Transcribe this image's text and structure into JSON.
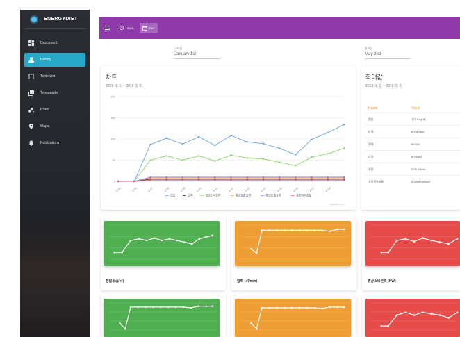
{
  "sidebar": {
    "brand": "ENERGYDIET",
    "items": [
      {
        "label": "Dashboard",
        "icon": "dashboard-icon"
      },
      {
        "label": "History",
        "icon": "person-icon",
        "active": true
      },
      {
        "label": "Table List",
        "icon": "clipboard-icon"
      },
      {
        "label": "Typography",
        "icon": "library-icon"
      },
      {
        "label": "Icons",
        "icon": "bubble-icon"
      },
      {
        "label": "Maps",
        "icon": "location-icon"
      },
      {
        "label": "Notifications",
        "icon": "bell-icon"
      }
    ]
  },
  "topbar": {
    "hour_label": "HOUR",
    "day_label": "DAY"
  },
  "dates": {
    "start_label": "시작일",
    "start_value": "January 1st",
    "end_label": "종료일",
    "end_value": "May 2nd"
  },
  "chart_card": {
    "title": "차트",
    "subtitle": "2019. 1. 1. ~ 2019. 5. 2.",
    "credit": "Highcharts.com"
  },
  "max_card": {
    "title": "최대값",
    "subtitle": "2019. 1. 1. ~ 2019. 5. 2.",
    "headers": [
      "Name",
      "Value"
    ],
    "rows": [
      {
        "name": "전압",
        "value": "172.9 kg/㎥"
      },
      {
        "name": "압력",
        "value": "6.9 ㎥/min"
      },
      {
        "name": "전력",
        "value": "99 KW"
      },
      {
        "name": "압력",
        "value": "6.9 kg/㎥"
      },
      {
        "name": "유량",
        "value": "0.05 ㎥/min"
      },
      {
        "name": "공정전력비율",
        "value": "0.1898 KWh/㎥"
      }
    ]
  },
  "mini_cards": [
    {
      "label": "전압 (kg/㎥)",
      "color": "green"
    },
    {
      "label": "압력 (㎥/min)",
      "color": "orange"
    },
    {
      "label": "평균소비전력 (KW)",
      "color": "red"
    }
  ],
  "colors": {
    "accent": "#8e3aaa",
    "active_nav": "#26a9c9",
    "green": "#4fae4f",
    "orange": "#ee9e34",
    "red": "#e54b48"
  },
  "chart_data": {
    "type": "line",
    "categories": [
      "4-05",
      "4-06",
      "4-07",
      "4-08",
      "4-09",
      "4-10",
      "4-11",
      "4-12",
      "4-13",
      "4-14",
      "4-15",
      "4-16",
      "4-17",
      "4-18"
    ],
    "ylim": [
      0,
      200
    ],
    "yticks": [
      "0",
      "50",
      "100",
      "150",
      "200"
    ],
    "series": [
      {
        "name": "전압",
        "color": "#6aa0e8",
        "values": [
          0,
          0,
          87,
          102,
          88,
          105,
          85,
          108,
          93,
          89,
          78,
          63,
          99,
          115,
          134
        ]
      },
      {
        "name": "압력",
        "color": "#333333",
        "values": [
          0,
          0,
          5,
          5,
          5,
          5,
          5,
          5,
          5,
          5,
          5,
          5,
          5,
          5,
          5
        ]
      },
      {
        "name": "평균소비전력",
        "color": "#8cd36b",
        "values": [
          0,
          0,
          50,
          60,
          50,
          60,
          48,
          62,
          55,
          53,
          45,
          37,
          57,
          65,
          78
        ]
      },
      {
        "name": "평균토출압력",
        "color": "#f0a35a",
        "values": [
          0,
          0,
          8,
          8,
          8,
          8,
          8,
          8,
          8,
          8,
          8,
          8,
          8,
          8,
          8
        ]
      },
      {
        "name": "평균토출유량",
        "color": "#8080e8",
        "values": [
          0,
          0,
          10,
          10,
          10,
          10,
          10,
          10,
          10,
          10,
          10,
          10,
          10,
          10,
          10
        ]
      },
      {
        "name": "운전전력효율",
        "color": "#e85a8a",
        "values": [
          0,
          0,
          3,
          3,
          3,
          3,
          3,
          3,
          3,
          3,
          3,
          3,
          3,
          3,
          3
        ]
      }
    ]
  }
}
